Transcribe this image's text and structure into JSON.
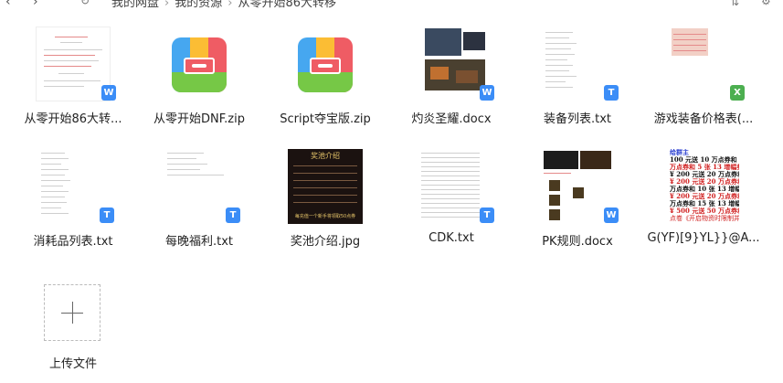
{
  "toolbar": {
    "breadcrumb": [
      "我的网盘",
      "我的资源",
      "从零开始86大转移"
    ]
  },
  "files": [
    {
      "name": "从零开始86大转...",
      "type": "docx",
      "badge": "W"
    },
    {
      "name": "从零开始DNF.zip",
      "type": "zip"
    },
    {
      "name": "Script夺宝版.zip",
      "type": "zip"
    },
    {
      "name": "灼炎圣耀.docx",
      "type": "docx",
      "badge": "W"
    },
    {
      "name": "装备列表.txt",
      "type": "txt",
      "badge": "T"
    },
    {
      "name": "游戏装备价格表(...",
      "type": "xls",
      "badge": "X"
    },
    {
      "name": "消耗品列表.txt",
      "type": "txt",
      "badge": "T"
    },
    {
      "name": "每晚福利.txt",
      "type": "txt",
      "badge": "T"
    },
    {
      "name": "奖池介绍.jpg",
      "type": "jpg"
    },
    {
      "name": "CDK.txt",
      "type": "txt",
      "badge": "T"
    },
    {
      "name": "PK规则.docx",
      "type": "docx",
      "badge": "W"
    },
    {
      "name": "G(YF)[9}YL}}@A...",
      "type": "image"
    }
  ],
  "upload": {
    "label": "上传文件"
  },
  "g_image_lines": [
    "给群主",
    "100 元送 10 万点券和 2 张 13",
    "万点券和 5 张 13 增幅券(账",
    "¥ 200 元送 20 万点券和 3 张",
    "¥ 200 元送 20 万点券和 5 张",
    "万点券和 10 张 13 增幅券(账",
    "¥ 200 元送 20 万点券和 5 张",
    "万点券和 15 张 13 增幅券(账",
    "¥ 500 元送 50 万点券和 10 张",
    "点卷《开启物资时限制并"
  ],
  "jpg_image_lines": {
    "title": "奖池介绍",
    "footer": "每充值一个新手将领取50点券"
  },
  "colors": {
    "blue_badge": "#3b8df7",
    "green_badge": "#4caf50"
  }
}
